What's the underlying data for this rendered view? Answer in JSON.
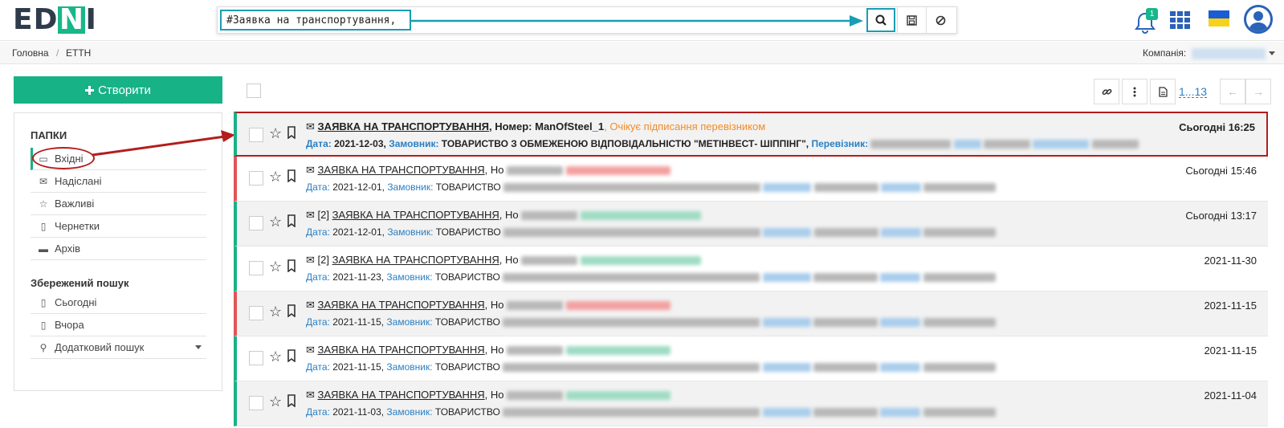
{
  "header": {
    "logo_text": "ED",
    "logo_letter": "N",
    "logo_tail": "I",
    "search": {
      "value": "#Заявка на транспортування,"
    },
    "search_icon": "search-icon",
    "save_icon": "save-icon",
    "clear_icon": "clear-icon",
    "notifications_count": "1",
    "flag_colors": [
      "#1a5bd6",
      "#f7d21b"
    ]
  },
  "breadcrumb": {
    "home": "Головна",
    "separator": "/",
    "current": "ЕТТН",
    "company_label": "Компанія:"
  },
  "sidebar": {
    "create_label": "Створити",
    "folders_title": "ПАПКИ",
    "folders": [
      {
        "label": "Вхідні",
        "icon": "inbox-icon"
      },
      {
        "label": "Надіслані",
        "icon": "envelope-icon"
      },
      {
        "label": "Важливі",
        "icon": "star-icon"
      },
      {
        "label": "Чернетки",
        "icon": "file-icon"
      },
      {
        "label": "Архів",
        "icon": "archive-icon"
      }
    ],
    "saved_title": "Збережений пошук",
    "saved": [
      {
        "label": "Сьогодні",
        "icon": "calendar-icon"
      },
      {
        "label": "Вчора",
        "icon": "calendar-icon"
      },
      {
        "label": "Додатковий пошук",
        "icon": "search-icon"
      }
    ]
  },
  "toolbar": {
    "pager": "1...13",
    "prev": "←",
    "next": "→"
  },
  "documents": [
    {
      "count": "",
      "title": "ЗАЯВКА НА ТРАНСПОРТУВАННЯ",
      "number_label": ", Номер: ",
      "number": "ManOfSteel_1",
      "status": ", Очікує підписання перевізником",
      "date_label": "Дата:",
      "date": "2021-12-03",
      "customer_label": "Замовник:",
      "customer": "ТОВАРИСТВО З ОБМЕЖЕНОЮ ВІДПОВІДАЛЬНІСТЮ \"МЕТІНВЕСТ- ШІППІНГ\",",
      "carrier_label": "Перевізник:",
      "time": "Сьогодні 16:25"
    },
    {
      "count": "",
      "title": "ЗАЯВКА НА ТРАНСПОРТУВАННЯ",
      "number_label": ", Но",
      "date_label": "Дата:",
      "date": "2021-12-01",
      "customer_label": "Замовник:",
      "customer": "ТОВАРИСТВО",
      "time": "Сьогодні 15:46"
    },
    {
      "count": "[2]",
      "title": "ЗАЯВКА НА ТРАНСПОРТУВАННЯ",
      "number_label": ", Но",
      "date_label": "Дата:",
      "date": "2021-12-01",
      "customer_label": "Замовник:",
      "customer": "ТОВАРИСТВО",
      "time": "Сьогодні 13:17"
    },
    {
      "count": "[2]",
      "title": "ЗАЯВКА НА ТРАНСПОРТУВАННЯ",
      "number_label": ", Но",
      "date_label": "Дата:",
      "date": "2021-11-23",
      "customer_label": "Замовник:",
      "customer": "ТОВАРИСТВО",
      "time": "2021-11-30"
    },
    {
      "count": "",
      "title": "ЗАЯВКА НА ТРАНСПОРТУВАННЯ",
      "number_label": ", Но",
      "date_label": "Дата:",
      "date": "2021-11-15",
      "customer_label": "Замовник:",
      "customer": "ТОВАРИСТВО",
      "time": "2021-11-15"
    },
    {
      "count": "",
      "title": "ЗАЯВКА НА ТРАНСПОРТУВАННЯ",
      "number_label": ", Но",
      "date_label": "Дата:",
      "date": "2021-11-15",
      "customer_label": "Замовник:",
      "customer": "ТОВАРИСТВО",
      "time": "2021-11-15"
    },
    {
      "count": "",
      "title": "ЗАЯВКА НА ТРАНСПОРТУВАННЯ",
      "number_label": ", Но",
      "date_label": "Дата:",
      "date": "2021-11-03",
      "customer_label": "Замовник:",
      "customer": "ТОВАРИСТВО",
      "time": "2021-11-04"
    }
  ],
  "colors": {
    "accent": "#18b287",
    "highlight": "#1a9db4",
    "annotation": "#b31d1d",
    "status_waiting": "#f08c2a",
    "status_error": "#e05555"
  }
}
